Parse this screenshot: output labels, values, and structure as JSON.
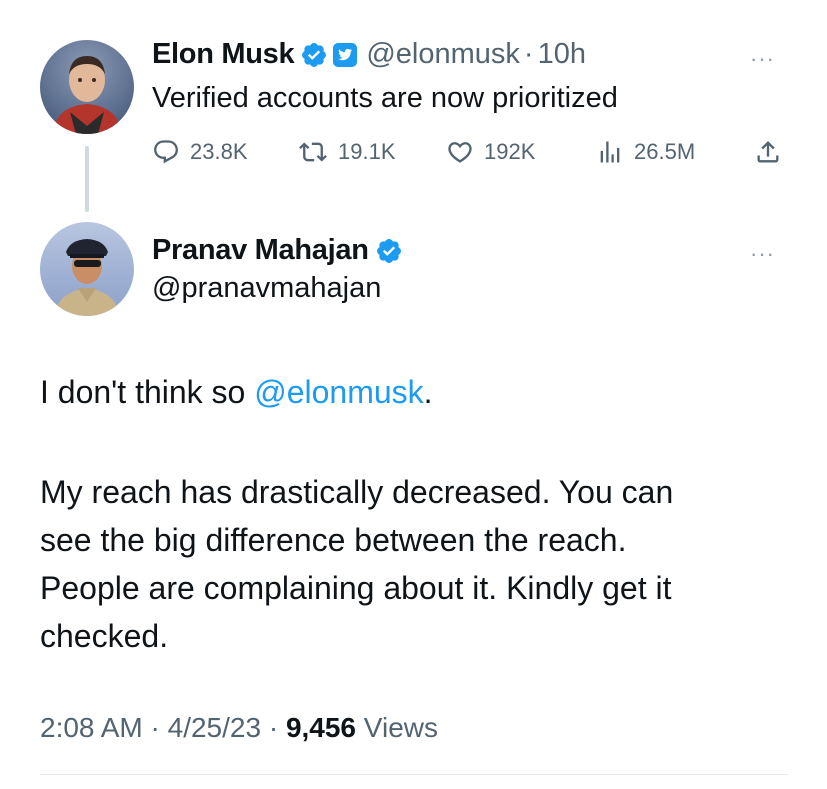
{
  "parent_tweet": {
    "name": "Elon Musk",
    "handle": "@elonmusk",
    "separator": "·",
    "time": "10h",
    "text": "Verified accounts are now prioritized",
    "more": "···",
    "stats": {
      "replies": "23.8K",
      "retweets": "19.1K",
      "likes": "192K",
      "views": "26.5M"
    }
  },
  "reply_tweet": {
    "name": "Pranav Mahajan",
    "handle": "@pranavmahajan",
    "more": "···",
    "line1_prefix": "I don't think so ",
    "line1_mention": "@elonmusk",
    "line1_suffix": ".",
    "paragraph_lines": [
      "My reach has drastically decreased. You can",
      "see the big difference between the reach.",
      "People are complaining about it. Kindly get it",
      "checked."
    ],
    "meta": {
      "time": "2:08 AM",
      "sep1": "·",
      "date": "4/25/23",
      "sep2": "·",
      "views_count": "9,456",
      "views_label": "Views"
    }
  },
  "colors": {
    "accent": "#1d9bf0",
    "text": "#0f1419",
    "muted": "#536471",
    "verified": "#1d9bf0",
    "thread_line": "#cfd9de"
  },
  "icons": [
    "verified-badge-icon",
    "twitter-blue-bird-icon",
    "reply-icon",
    "retweet-icon",
    "like-icon",
    "views-icon",
    "share-icon",
    "more-icon"
  ]
}
